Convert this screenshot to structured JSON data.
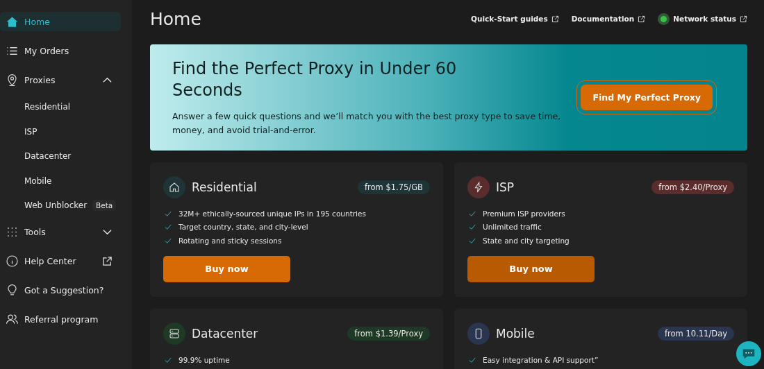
{
  "sidebar": {
    "items": [
      {
        "kind": "link",
        "label": "Home",
        "selected": true
      },
      {
        "kind": "link",
        "label": "My Orders",
        "selected": false
      },
      {
        "kind": "group",
        "label": "Proxies",
        "selected": false,
        "expanded": true,
        "children": [
          {
            "label": "Residential",
            "selected": false
          },
          {
            "label": "ISP",
            "selected": false
          },
          {
            "label": "Datacenter",
            "selected": false
          },
          {
            "label": "Mobile",
            "selected": false
          },
          {
            "label": "Web Unblocker",
            "badge": "Beta",
            "selected": false
          }
        ]
      },
      {
        "kind": "group",
        "label": "Tools",
        "selected": false,
        "expanded": false
      },
      {
        "kind": "external",
        "label": "Help Center",
        "selected": false
      },
      {
        "kind": "link",
        "label": "Got a Suggestion?",
        "selected": false
      },
      {
        "kind": "link",
        "label": "Referral program",
        "selected": false
      }
    ]
  },
  "page_title": "Home",
  "top_links": [
    {
      "label": "Quick-Start guides"
    },
    {
      "label": "Documentation"
    },
    {
      "label": "Network status",
      "color": "#3cc14a"
    }
  ],
  "hero": {
    "title": "Find the Perfect Proxy in Under 60 Seconds",
    "text": "Answer a few quick questions and we’ll match you with the best proxy type to save time, money, and avoid trial-and-error.",
    "button": "Find My Perfect Proxy"
  },
  "cards": [
    {
      "title": "Residential",
      "price": "from $1.75/GB",
      "color": "#1e3436",
      "features": [
        "32M+ ethically-sourced unique IPs in 195 countries",
        "Target country, state, and city-level",
        "Rotating and sticky sessions"
      ],
      "button": "Buy now",
      "hovered": false
    },
    {
      "title": "ISP",
      "price": "from $2.40/Proxy",
      "color": "#5a2c2c",
      "features": [
        "Premium ISP providers",
        "Unlimited traffic",
        "State and city targeting"
      ],
      "button": "Buy now",
      "hovered": true
    },
    {
      "title": "Datacenter",
      "price": "from $1.39/Proxy",
      "color": "#1e3a24",
      "features": [
        "99.9% uptime"
      ]
    },
    {
      "title": "Mobile",
      "price": "from 10.11/Day",
      "color": "#2a3550",
      "features": [
        "Easy integration & API support”"
      ]
    }
  ]
}
